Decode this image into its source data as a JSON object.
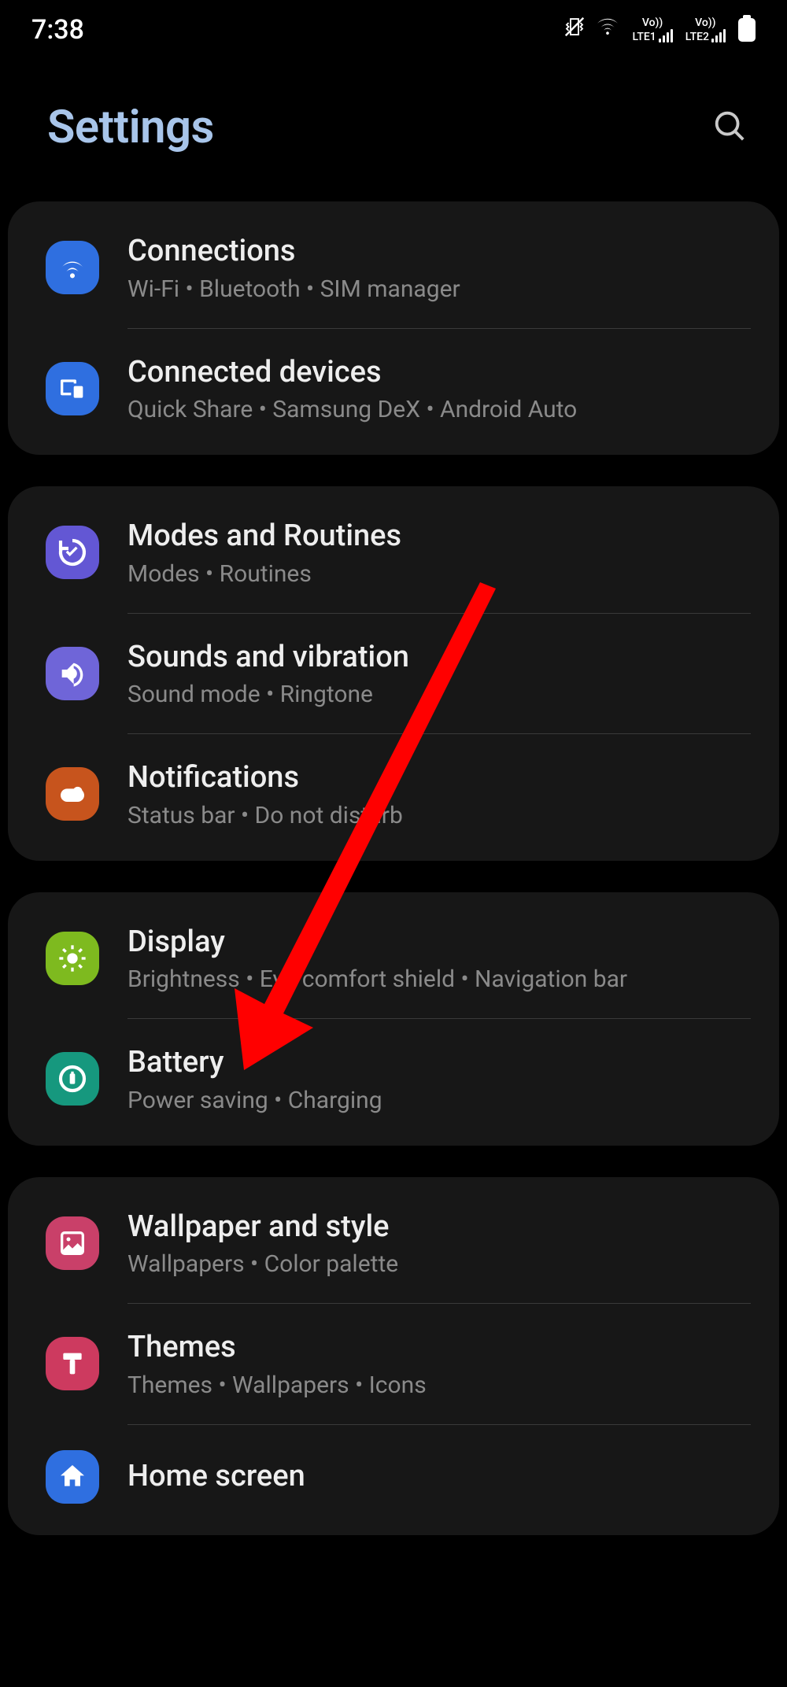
{
  "status": {
    "time": "7:38",
    "sim1": "LTE1",
    "sim2": "LTE2",
    "vo1": "Vo))",
    "vo2": "Vo))"
  },
  "header": {
    "title": "Settings"
  },
  "groups": [
    {
      "items": [
        {
          "title": "Connections",
          "sub": "Wi-Fi  •  Bluetooth  •  SIM manager",
          "icon": "wifi",
          "color": "ic-blue",
          "name": "settings-item-connections"
        },
        {
          "title": "Connected devices",
          "sub": "Quick Share  •  Samsung DeX  •  Android Auto",
          "icon": "devices",
          "color": "ic-blue",
          "name": "settings-item-connected-devices"
        }
      ]
    },
    {
      "items": [
        {
          "title": "Modes and Routines",
          "sub": "Modes  •  Routines",
          "icon": "routine",
          "color": "ic-purple",
          "name": "settings-item-modes-routines"
        },
        {
          "title": "Sounds and vibration",
          "sub": "Sound mode  •  Ringtone",
          "icon": "sound",
          "color": "ic-lavender",
          "name": "settings-item-sounds-vibration"
        },
        {
          "title": "Notifications",
          "sub": "Status bar  •  Do not disturb",
          "icon": "notif",
          "color": "ic-orange",
          "name": "settings-item-notifications"
        }
      ]
    },
    {
      "items": [
        {
          "title": "Display",
          "sub": "Brightness  •  Eye comfort shield  •  Navigation bar",
          "icon": "brightness",
          "color": "ic-green",
          "name": "settings-item-display"
        },
        {
          "title": "Battery",
          "sub": "Power saving  •  Charging",
          "icon": "battery",
          "color": "ic-teal",
          "name": "settings-item-battery"
        }
      ]
    },
    {
      "items": [
        {
          "title": "Wallpaper and style",
          "sub": "Wallpapers  •  Color palette",
          "icon": "picture",
          "color": "ic-pink",
          "name": "settings-item-wallpaper-style"
        },
        {
          "title": "Themes",
          "sub": "Themes  •  Wallpapers  •  Icons",
          "icon": "theme",
          "color": "ic-rose",
          "name": "settings-item-themes"
        },
        {
          "title": "Home screen",
          "sub": "",
          "icon": "home",
          "color": "ic-blue",
          "name": "settings-item-home-screen"
        }
      ]
    }
  ]
}
